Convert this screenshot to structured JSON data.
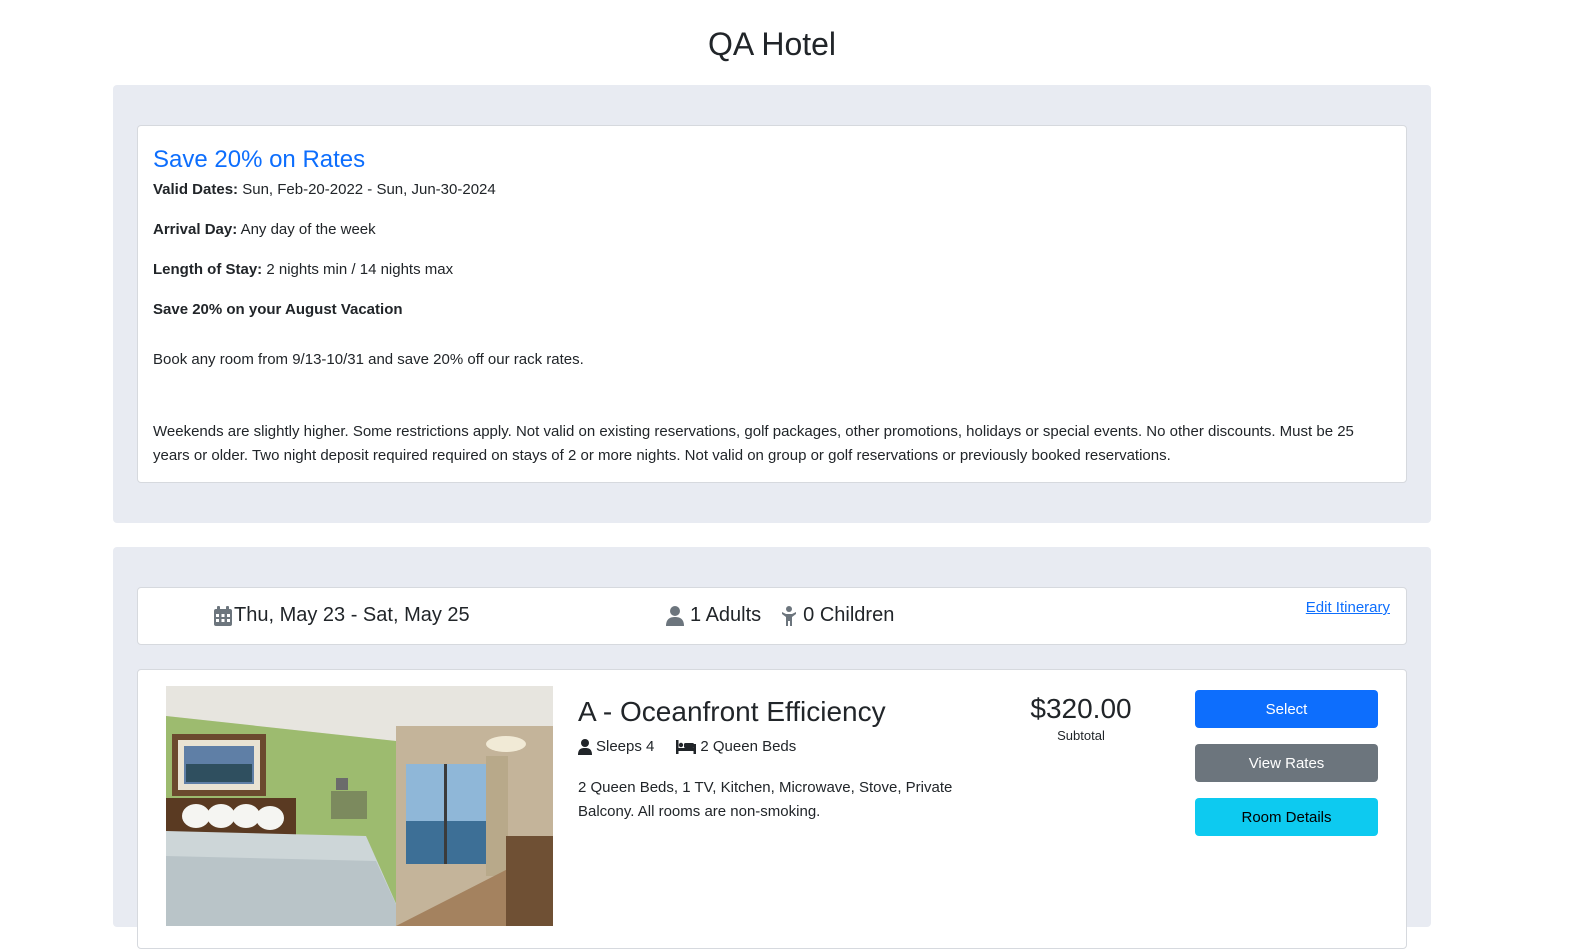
{
  "page": {
    "title": "QA Hotel"
  },
  "promo": {
    "title": "Save 20% on Rates",
    "valid_dates_label": "Valid Dates:",
    "valid_dates_value": "Sun, Feb-20-2022 - Sun, Jun-30-2024",
    "arrival_day_label": "Arrival Day:",
    "arrival_day_value": "Any day of the week",
    "length_of_stay_label": "Length of Stay:",
    "length_of_stay_value": "2 nights min / 14 nights max",
    "heading": "Save 20% on your August Vacation",
    "paragraph_1": "Book any room from 9/13-10/31 and save 20% off our rack rates.",
    "paragraph_2": "Weekends are slightly higher. Some restrictions apply. Not valid on existing reservations, golf packages, other promotions, holidays or special events. No other discounts. Must be 25 years or older. Two night deposit required required on stays of 2 or more nights. Not valid on group or golf reservations or previously booked reservations."
  },
  "itinerary": {
    "dates": "Thu, May 23 - Sat, May 25",
    "adults": "1 Adults",
    "children": "0 Children",
    "edit_link": "Edit Itinerary",
    "icons": [
      "calendar-icon",
      "adult-icon",
      "child-icon"
    ]
  },
  "room": {
    "name": "A - Oceanfront Efficiency",
    "sleeps": "Sleeps 4",
    "beds": "2 Queen Beds",
    "description": "2 Queen Beds, 1 TV, Kitchen, Microwave, Stove, Private Balcony. All rooms are non-smoking.",
    "price": "$320.00",
    "price_label": "Subtotal",
    "buttons": {
      "select": "Select",
      "view_rates": "View Rates",
      "room_details": "Room Details"
    },
    "icons": [
      "person-icon",
      "bed-icon"
    ]
  },
  "colors": {
    "accent": "#0d6efd",
    "panel_bg": "#e8ebf2",
    "secondary": "#6c757d",
    "info": "#0dcaf0"
  }
}
